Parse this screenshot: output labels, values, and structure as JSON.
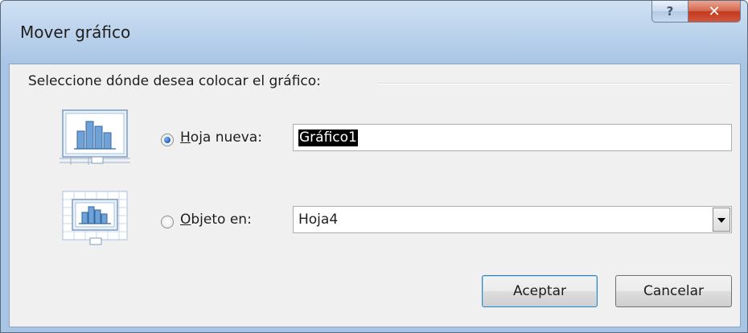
{
  "window": {
    "title": "Mover gráfico",
    "help_glyph": "?",
    "close_glyph": "✕"
  },
  "group": {
    "label": "Seleccione dónde desea colocar el gráfico:"
  },
  "options": {
    "new_sheet": {
      "accel": "H",
      "label_rest": "oja nueva:",
      "value": "Gráfico1",
      "selected": true,
      "icon": "chart-sheet-icon"
    },
    "object_in": {
      "accel": "O",
      "label_rest": "bjeto en:",
      "value": "Hoja4",
      "selected": false,
      "icon": "embedded-chart-icon"
    }
  },
  "buttons": {
    "accept": "Aceptar",
    "cancel": "Cancelar"
  },
  "colors": {
    "title_gradient_top": "#cfe0f3",
    "close_red": "#c2391f",
    "radio_dot": "#1f5fb8",
    "default_button_border": "#3c7fb1"
  }
}
